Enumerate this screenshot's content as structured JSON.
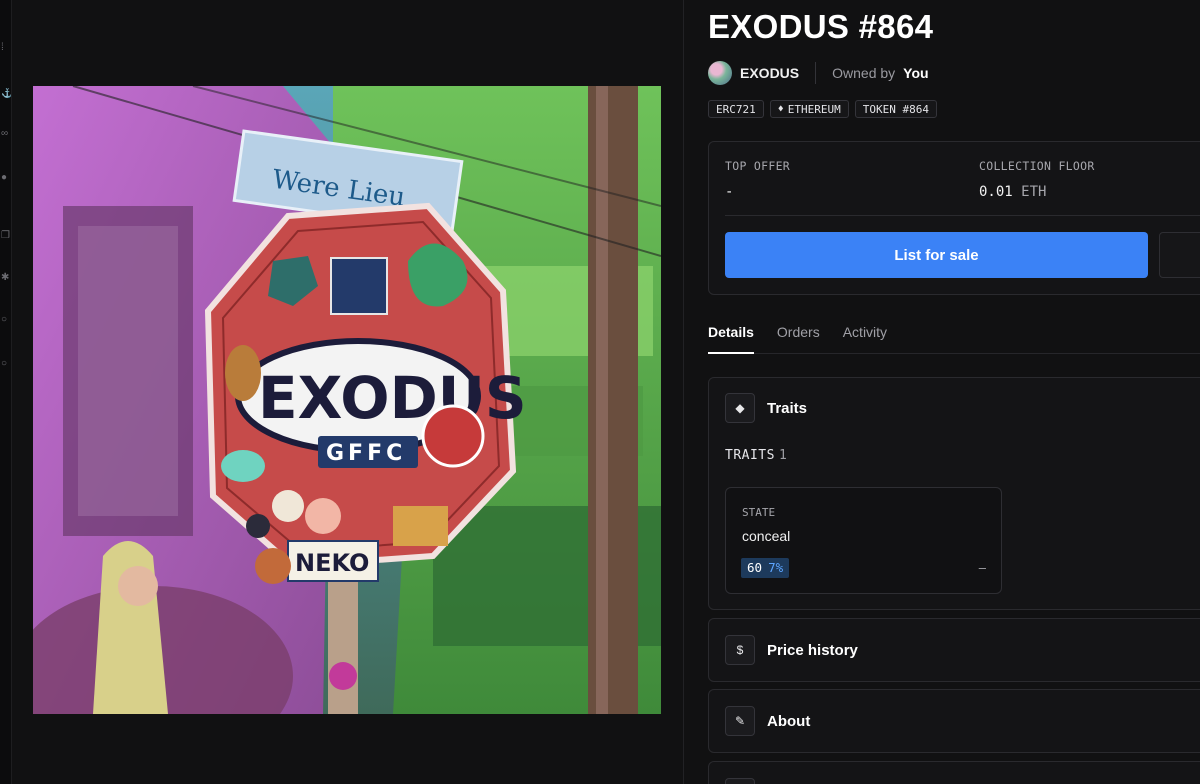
{
  "sidebar": {
    "icons": [
      "grip-icon",
      "anchor-icon",
      "link-icon",
      "avatar-dot-icon",
      "copy-icon",
      "puzzle-icon",
      "circle-icon",
      "circle-icon"
    ]
  },
  "nft": {
    "title": "EXODUS #864",
    "image_description": "sticker-covered stop sign artwork"
  },
  "collection": {
    "name": "EXODUS",
    "owned_label": "Owned by",
    "owner": "You"
  },
  "badges": {
    "standard": "ERC721",
    "chain": "ETHEREUM",
    "token": "TOKEN #864"
  },
  "offers": {
    "top_offer_label": "TOP OFFER",
    "top_offer_value": "-",
    "floor_label": "COLLECTION FLOOR",
    "floor_value": "0.01",
    "floor_unit": "ETH",
    "list_button": "List for sale"
  },
  "tabs": [
    {
      "label": "Details",
      "active": true
    },
    {
      "label": "Orders",
      "active": false
    },
    {
      "label": "Activity",
      "active": false
    }
  ],
  "traits": {
    "title": "Traits",
    "count_label": "TRAITS",
    "count": "1",
    "items": [
      {
        "type": "STATE",
        "value": "conceal",
        "count": "60",
        "percent": "7%",
        "price": "–"
      }
    ]
  },
  "sections": {
    "price_history": "Price history",
    "about": "About"
  },
  "colors": {
    "accent": "#3b82f6",
    "background": "#111112",
    "card": "#141416",
    "trait_chip": "#1d3a5c"
  }
}
